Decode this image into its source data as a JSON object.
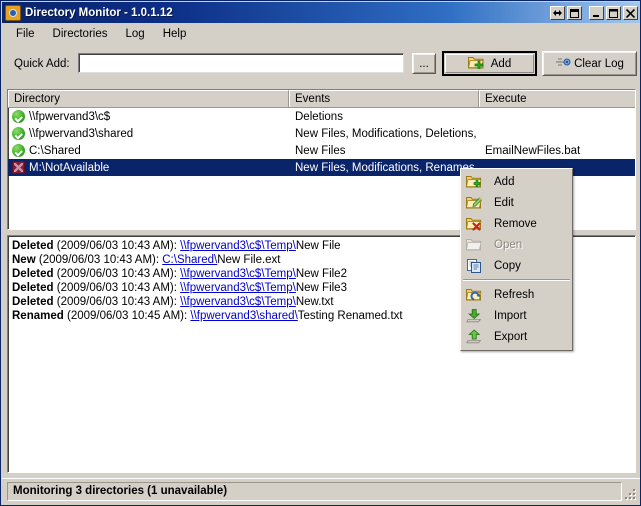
{
  "window": {
    "title": "Directory Monitor - 1.0.1.12",
    "icon": "app-folder-icon",
    "buttons": [
      {
        "name": "roll-up-button",
        "glyph": "↔"
      },
      {
        "name": "stay-on-top-button",
        "glyph": "❐"
      },
      {
        "name": "minimize-button",
        "glyph": "—"
      },
      {
        "name": "maximize-button",
        "glyph": "□"
      },
      {
        "name": "close-button",
        "glyph": "✕"
      }
    ]
  },
  "menubar": {
    "items": [
      {
        "name": "menu-file",
        "label": "File"
      },
      {
        "name": "menu-directories",
        "label": "Directories"
      },
      {
        "name": "menu-log",
        "label": "Log"
      },
      {
        "name": "menu-help",
        "label": "Help"
      }
    ]
  },
  "toolbar": {
    "quick_add_label": "Quick Add:",
    "quick_add_value": "",
    "quick_add_placeholder": "",
    "browse_label": "...",
    "add_label": "Add",
    "clear_log_label": "Clear Log"
  },
  "list": {
    "columns": [
      {
        "name": "column-directory",
        "label": "Directory"
      },
      {
        "name": "column-events",
        "label": "Events"
      },
      {
        "name": "column-execute",
        "label": "Execute"
      }
    ],
    "rows": [
      {
        "status": "ok",
        "directory": "\\\\fpwervand3\\c$",
        "events": "Deletions",
        "execute": "",
        "selected": false
      },
      {
        "status": "ok",
        "directory": "\\\\fpwervand3\\shared",
        "events": "New Files, Modifications, Deletions, ...",
        "execute": "",
        "selected": false
      },
      {
        "status": "ok",
        "directory": "C:\\Shared",
        "events": "New Files",
        "execute": "EmailNewFiles.bat",
        "selected": false
      },
      {
        "status": "unavailable",
        "directory": "M:\\NotAvailable",
        "events": "New Files, Modifications, Renames",
        "execute": "",
        "selected": true
      }
    ]
  },
  "log": {
    "entries": [
      {
        "action": "Deleted",
        "timestamp": "(2009/06/03 10:43 AM): ",
        "link": "\\\\fpwervand3\\c$\\Temp\\",
        "rest": "New File"
      },
      {
        "action": "New",
        "timestamp": "(2009/06/03 10:43 AM): ",
        "link": "C:\\Shared\\",
        "rest": "New File.ext"
      },
      {
        "action": "Deleted",
        "timestamp": "(2009/06/03 10:43 AM): ",
        "link": "\\\\fpwervand3\\c$\\Temp\\",
        "rest": "New File2"
      },
      {
        "action": "Deleted",
        "timestamp": "(2009/06/03 10:43 AM): ",
        "link": "\\\\fpwervand3\\c$\\Temp\\",
        "rest": "New File3"
      },
      {
        "action": "Deleted",
        "timestamp": "(2009/06/03 10:43 AM): ",
        "link": "\\\\fpwervand3\\c$\\Temp\\",
        "rest": "New.txt"
      },
      {
        "action": "Renamed",
        "timestamp": "(2009/06/03 10:45 AM): ",
        "link": "\\\\fpwervand3\\shared\\",
        "rest": "Testing Renamed.txt"
      }
    ]
  },
  "context_menu": {
    "items": [
      {
        "name": "ctx-add",
        "label": "Add",
        "icon": "folder-add-icon",
        "disabled": false,
        "separator_after": false
      },
      {
        "name": "ctx-edit",
        "label": "Edit",
        "icon": "folder-edit-icon",
        "disabled": false,
        "separator_after": false
      },
      {
        "name": "ctx-remove",
        "label": "Remove",
        "icon": "folder-remove-icon",
        "disabled": false,
        "separator_after": false
      },
      {
        "name": "ctx-open",
        "label": "Open",
        "icon": "folder-open-icon",
        "disabled": true,
        "separator_after": false
      },
      {
        "name": "ctx-copy",
        "label": "Copy",
        "icon": "copy-icon",
        "disabled": false,
        "separator_after": true
      },
      {
        "name": "ctx-refresh",
        "label": "Refresh",
        "icon": "folder-refresh-icon",
        "disabled": false,
        "separator_after": false
      },
      {
        "name": "ctx-import",
        "label": "Import",
        "icon": "import-arrow-icon",
        "disabled": false,
        "separator_after": false
      },
      {
        "name": "ctx-export",
        "label": "Export",
        "icon": "export-arrow-icon",
        "disabled": false,
        "separator_after": false
      }
    ]
  },
  "statusbar": {
    "text": "Monitoring 3 directories (1 unavailable)"
  },
  "colors": {
    "title_start": "#0a246a",
    "title_end": "#a6c8ec",
    "face": "#d4d0c8",
    "selection": "#0a246a",
    "link": "#0000cc",
    "status_ok": "#3fae2a",
    "status_bad": "#7e1f3a"
  }
}
